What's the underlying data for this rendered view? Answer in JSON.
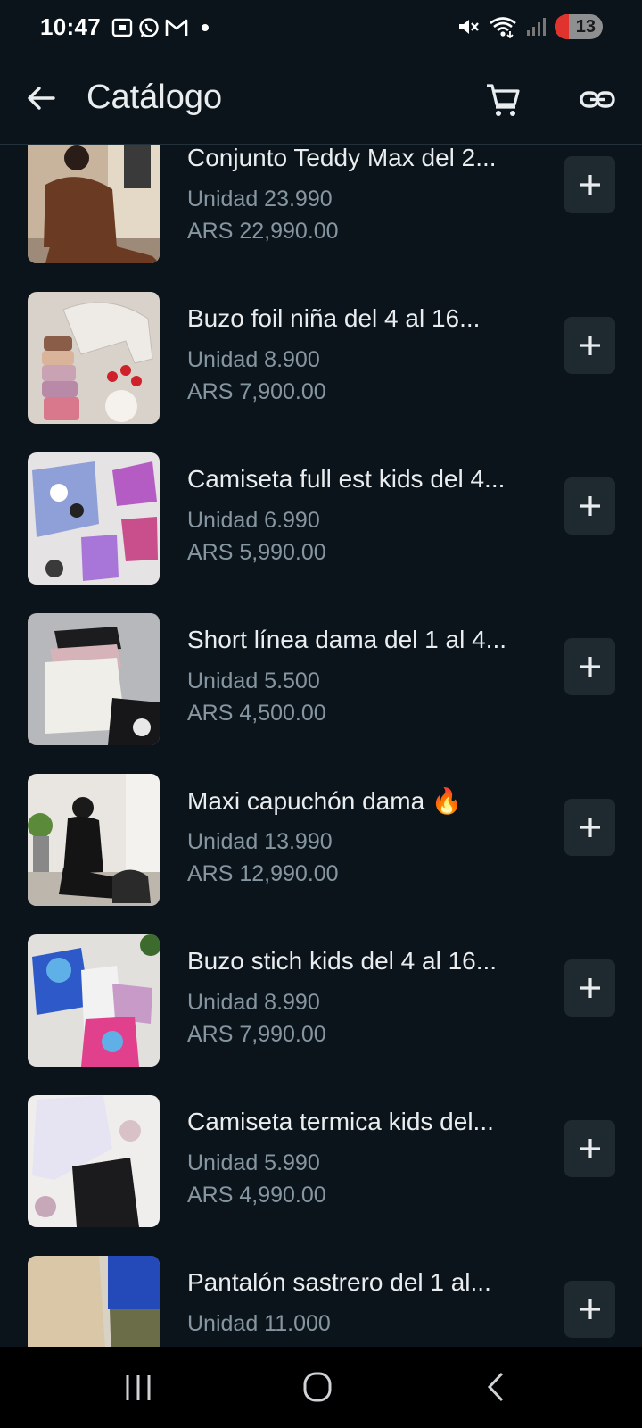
{
  "status_bar": {
    "time": "10:47",
    "battery": "13"
  },
  "header": {
    "title": "Catálogo"
  },
  "products": [
    {
      "name": "Conjunto Teddy Max del 2...",
      "unit": "Unidad 23.990",
      "price": "ARS 22,990.00"
    },
    {
      "name": "Buzo foil niña del 4 al 16...",
      "unit": "Unidad 8.900",
      "price": "ARS 7,900.00"
    },
    {
      "name": "Camiseta full est kids del 4...",
      "unit": "Unidad 6.990",
      "price": "ARS 5,990.00"
    },
    {
      "name": "Short línea dama del 1 al 4...",
      "unit": "Unidad 5.500",
      "price": "ARS 4,500.00"
    },
    {
      "name": "Maxi capuchón dama 🔥",
      "unit": "Unidad 13.990",
      "price": "ARS 12,990.00"
    },
    {
      "name": "Buzo stich kids del 4 al 16...",
      "unit": "Unidad 8.990",
      "price": "ARS 7,990.00"
    },
    {
      "name": "Camiseta termica kids del...",
      "unit": "Unidad 5.990",
      "price": "ARS 4,990.00"
    },
    {
      "name": "Pantalón sastrero del 1 al...",
      "unit": "Unidad 11.000",
      "price": ""
    }
  ],
  "icons": {
    "back": "arrow-left-icon",
    "cart": "cart-icon",
    "link": "link-icon",
    "add": "plus-icon",
    "nav_recents": "recents-icon",
    "nav_home": "home-icon",
    "nav_back": "back-chevron-icon"
  },
  "colors": {
    "background": "#0b141a",
    "text_secondary": "#8696a0",
    "button_bg": "#1f2a30"
  }
}
